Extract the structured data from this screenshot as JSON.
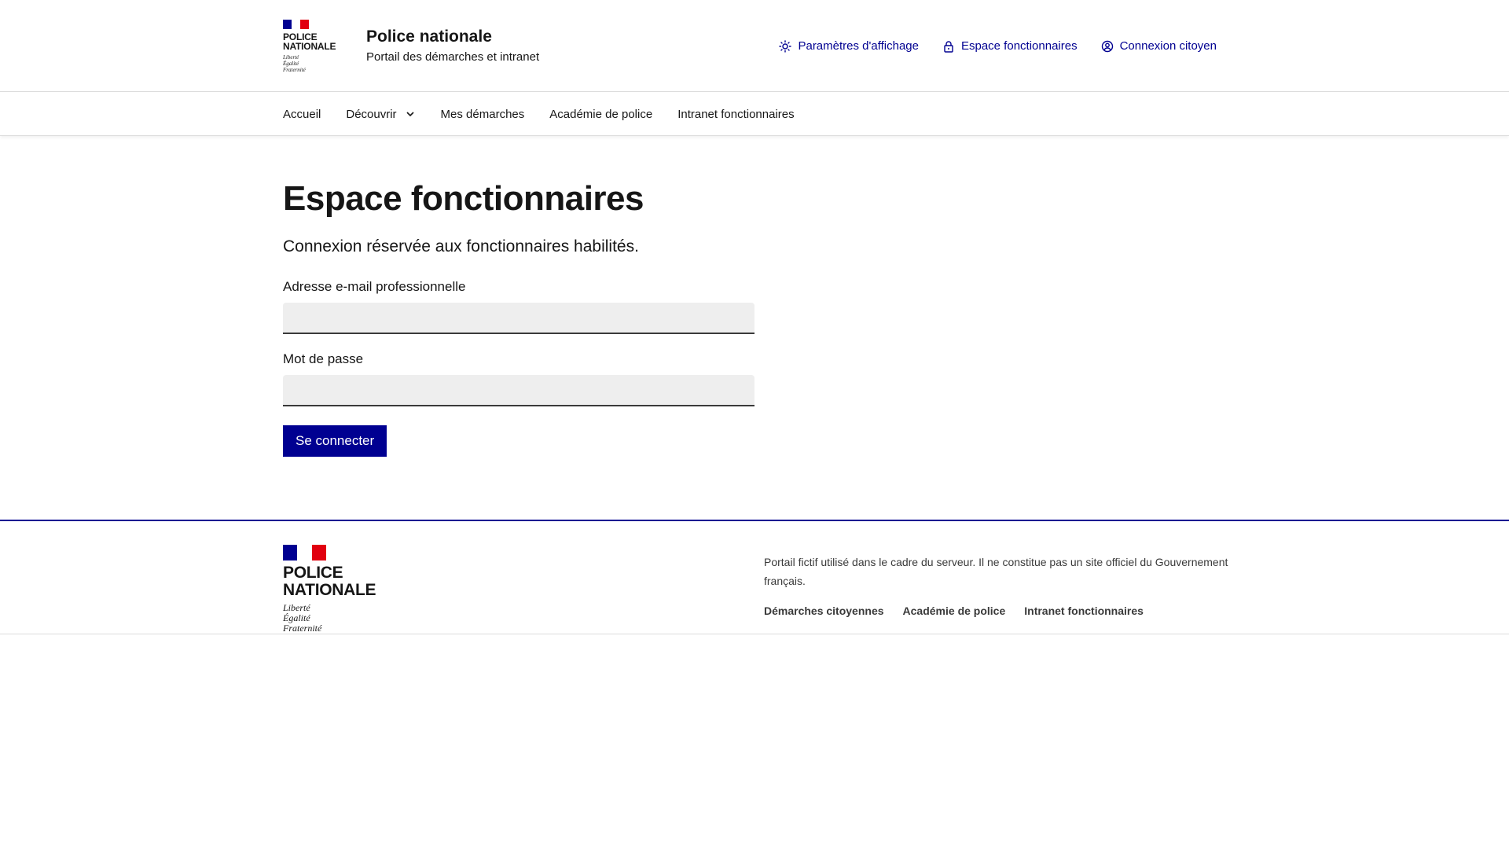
{
  "header": {
    "logo": {
      "line1": "POLICE",
      "line2": "NATIONALE",
      "motto1": "Liberté",
      "motto2": "Égalité",
      "motto3": "Fraternité"
    },
    "service_title": "Police nationale",
    "service_tagline": "Portail des démarches et intranet",
    "tools": [
      {
        "label": "Paramètres d'affichage",
        "icon": "sun-icon"
      },
      {
        "label": "Espace fonctionnaires",
        "icon": "lock-icon"
      },
      {
        "label": "Connexion citoyen",
        "icon": "user-icon"
      }
    ]
  },
  "nav": {
    "items": [
      {
        "label": "Accueil"
      },
      {
        "label": "Découvrir",
        "icon": "chevron-down-icon"
      },
      {
        "label": "Mes démarches"
      },
      {
        "label": "Académie de police"
      },
      {
        "label": "Intranet fonctionnaires"
      }
    ]
  },
  "main": {
    "title": "Espace fonctionnaires",
    "lead": "Connexion réservée aux fonctionnaires habilités.",
    "email_label": "Adresse e-mail professionnelle",
    "email_value": "",
    "password_label": "Mot de passe",
    "password_value": "",
    "submit_label": "Se connecter"
  },
  "footer": {
    "logo": {
      "line1": "POLICE",
      "line2": "NATIONALE",
      "motto1": "Liberté",
      "motto2": "Égalité",
      "motto3": "Fraternité"
    },
    "description": "Portail fictif utilisé dans le cadre du serveur. Il ne constitue pas un site officiel du Gouvernement français.",
    "links": [
      {
        "label": "Démarches citoyennes"
      },
      {
        "label": "Académie de police"
      },
      {
        "label": "Intranet fonctionnaires"
      }
    ]
  },
  "colors": {
    "primary": "#000091",
    "flag_red": "#e1000f",
    "text": "#161616",
    "input_bg": "#eeeeee"
  }
}
